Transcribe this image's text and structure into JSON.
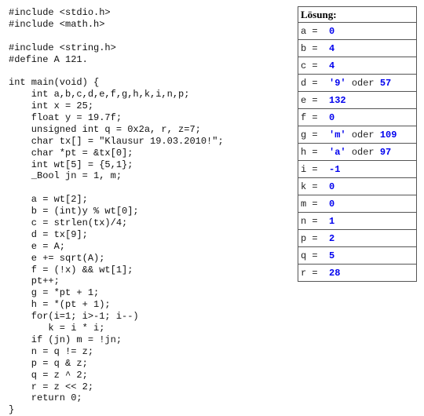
{
  "code": {
    "lines": [
      "#include <stdio.h>",
      "#include <math.h>",
      "",
      "#include <string.h>",
      "#define A 121.",
      "",
      "int main(void) {",
      "    int a,b,c,d,e,f,g,h,k,i,n,p;",
      "    int x = 25;",
      "    float y = 19.7f;",
      "    unsigned int q = 0x2a, r, z=7;",
      "    char tx[] = \"Klausur 19.03.2010!\";",
      "    char *pt = &tx[0];",
      "    int wt[5] = {5,1};",
      "    _Bool jn = 1, m;",
      "",
      "    a = wt[2];",
      "    b = (int)y % wt[0];",
      "    c = strlen(tx)/4;",
      "    d = tx[9];",
      "    e = A;",
      "    e += sqrt(A);",
      "    f = (!x) && wt[1];",
      "    pt++;",
      "    g = *pt + 1;",
      "    h = *(pt + 1);",
      "    for(i=1; i>-1; i--)",
      "       k = i * i;",
      "    if (jn) m = !jn;",
      "    n = q != z;",
      "    p = q & z;",
      "    q = z ^ 2;",
      "    r = z << 2;",
      "    return 0;",
      "}"
    ]
  },
  "solution": {
    "title": "Lösung:",
    "rows": [
      {
        "var": "a",
        "eq": " =  ",
        "val": "0",
        "oder": "",
        "alt": ""
      },
      {
        "var": "b",
        "eq": " =  ",
        "val": "4",
        "oder": "",
        "alt": ""
      },
      {
        "var": "c",
        "eq": " =  ",
        "val": "4",
        "oder": "",
        "alt": ""
      },
      {
        "var": "d",
        "eq": " =  ",
        "val": "'9'",
        "oder": " oder ",
        "alt": "57"
      },
      {
        "var": "e",
        "eq": " =  ",
        "val": "132",
        "oder": "",
        "alt": ""
      },
      {
        "var": "f",
        "eq": " =  ",
        "val": "0",
        "oder": "",
        "alt": ""
      },
      {
        "var": "g",
        "eq": " =  ",
        "val": "'m'",
        "oder": " oder ",
        "alt": "109"
      },
      {
        "var": "h",
        "eq": " =  ",
        "val": "'a'",
        "oder": " oder ",
        "alt": "97"
      },
      {
        "var": "i",
        "eq": " =  ",
        "val": "-1",
        "oder": "",
        "alt": ""
      },
      {
        "var": "k",
        "eq": " =  ",
        "val": "0",
        "oder": "",
        "alt": ""
      },
      {
        "var": "m",
        "eq": " =  ",
        "val": "0",
        "oder": "",
        "alt": ""
      },
      {
        "var": "n",
        "eq": " =  ",
        "val": "1",
        "oder": "",
        "alt": ""
      },
      {
        "var": "p",
        "eq": " =  ",
        "val": "2",
        "oder": "",
        "alt": ""
      },
      {
        "var": "q",
        "eq": " =  ",
        "val": "5",
        "oder": "",
        "alt": ""
      },
      {
        "var": "r",
        "eq": " =  ",
        "val": "28",
        "oder": "",
        "alt": ""
      }
    ]
  }
}
